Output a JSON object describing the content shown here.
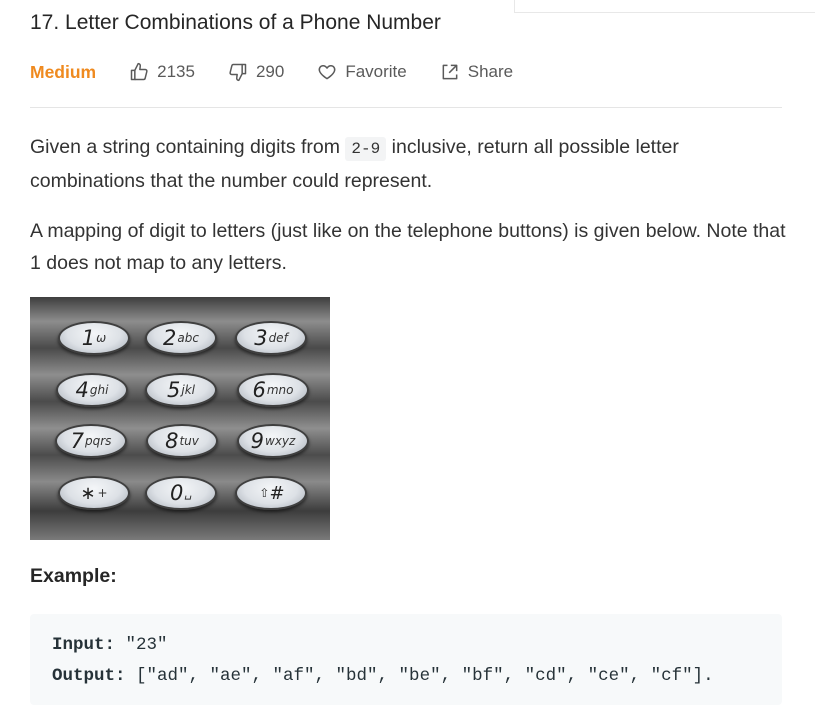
{
  "problem": {
    "title": "17. Letter Combinations of a Phone Number",
    "difficulty": "Medium",
    "likes": "2135",
    "dislikes": "290",
    "favorite_label": "Favorite",
    "share_label": "Share",
    "colors": {
      "difficulty": "#ef8a1f",
      "text": "#262626",
      "muted": "#5a5a5a"
    }
  },
  "description": {
    "p1_before": "Given a string containing digits from ",
    "p1_code": "2-9",
    "p1_after": " inclusive, return all possible letter combinations that the number could represent.",
    "p2": "A mapping of digit to letters (just like on the telephone buttons) is given below. Note that 1 does not map to any letters."
  },
  "keypad": {
    "keys": [
      {
        "digit": "1",
        "letters": "ω"
      },
      {
        "digit": "2",
        "letters": "abc"
      },
      {
        "digit": "3",
        "letters": "def"
      },
      {
        "digit": "4",
        "letters": "ghi"
      },
      {
        "digit": "5",
        "letters": "jkl"
      },
      {
        "digit": "6",
        "letters": "mno"
      },
      {
        "digit": "7",
        "letters": "pqrs"
      },
      {
        "digit": "8",
        "letters": "tuv"
      },
      {
        "digit": "9",
        "letters": "wxyz"
      },
      {
        "digit": "∗",
        "letters": "+"
      },
      {
        "digit": "0",
        "letters": "␣"
      },
      {
        "digit": "#",
        "letters": "⇧"
      }
    ]
  },
  "example": {
    "heading": "Example:",
    "input_label": "Input:",
    "input_value": " \"23\"",
    "output_label": "Output:",
    "output_value": " [\"ad\", \"ae\", \"af\", \"bd\", \"be\", \"bf\", \"cd\", \"ce\", \"cf\"]."
  }
}
